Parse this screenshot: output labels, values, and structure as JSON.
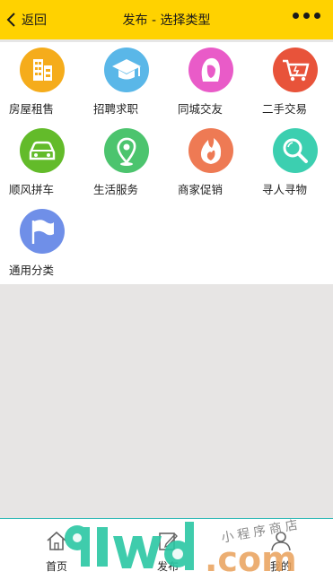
{
  "navbar": {
    "back_label": "返回",
    "title": "发布 - 选择类型"
  },
  "categories": [
    {
      "label": "房屋租售",
      "icon": "building-icon",
      "color": "#f5ac1b"
    },
    {
      "label": "招聘求职",
      "icon": "graduation-cap-icon",
      "color": "#5ab7e8"
    },
    {
      "label": "同城交友",
      "icon": "woman-face-icon",
      "color": "#e95bc8"
    },
    {
      "label": "二手交易",
      "icon": "shopping-cart-icon",
      "color": "#e8533a"
    },
    {
      "label": "顺风拼车",
      "icon": "car-icon",
      "color": "#63bb2a"
    },
    {
      "label": "生活服务",
      "icon": "location-pin-icon",
      "color": "#4cc46e"
    },
    {
      "label": "商家促销",
      "icon": "flame-icon",
      "color": "#ee7a54"
    },
    {
      "label": "寻人寻物",
      "icon": "magnifier-icon",
      "color": "#3ccfb0"
    },
    {
      "label": "通用分类",
      "icon": "flag-icon",
      "color": "#6f8fe8"
    }
  ],
  "tabbar": {
    "items": [
      {
        "label": "首页",
        "icon": "home-icon"
      },
      {
        "label": "发布",
        "icon": "edit-icon"
      },
      {
        "label": "我的",
        "icon": "user-icon"
      }
    ]
  },
  "watermark": {
    "big": "91wd",
    "suffix": ".com",
    "script": "小程序商店"
  },
  "colors": {
    "navbar": "#ffd200",
    "tabbar_border": "#20b6b3",
    "page_bg": "#e7e5e4"
  }
}
